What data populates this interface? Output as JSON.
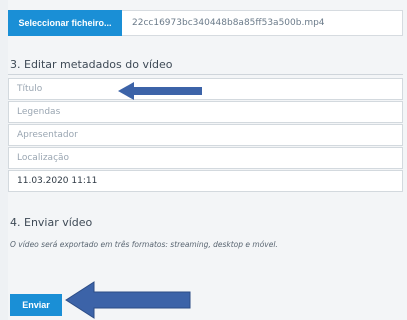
{
  "upload": {
    "select_file_label": "Seleccionar ficheiro...",
    "file_name": "22cc16973bc340448b8a85ff53a500b.mp4"
  },
  "metadata": {
    "section_title": "3. Editar metadados do vídeo",
    "fields": [
      {
        "placeholder": "Título",
        "value": ""
      },
      {
        "placeholder": "Legendas",
        "value": ""
      },
      {
        "placeholder": "Apresentador",
        "value": ""
      },
      {
        "placeholder": "Localização",
        "value": ""
      },
      {
        "placeholder": "",
        "value": "11.03.2020 11:11"
      }
    ]
  },
  "send": {
    "section_title": "4. Enviar vídeo",
    "note": "O vídeo será exportado em três formatos: streaming, desktop e móvel.",
    "button_label": "Enviar"
  },
  "colors": {
    "primary": "#1a8fd6",
    "annotation_arrow": "#3c63a8"
  }
}
